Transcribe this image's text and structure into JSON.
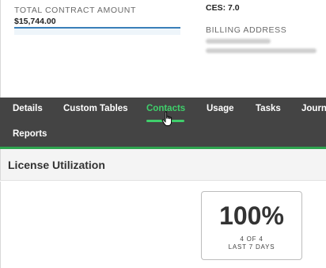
{
  "contract": {
    "amount_label": "TOTAL CONTRACT AMOUNT",
    "amount_value": "$15,744.00"
  },
  "ces": "CES: 7.0",
  "billing": {
    "label": "BILLING ADDRESS",
    "line1": "(obscured)",
    "line2": "(obscured)"
  },
  "tabs": [
    {
      "label": "Details"
    },
    {
      "label": "Custom Tables"
    },
    {
      "label": "Contacts"
    },
    {
      "label": "Usage"
    },
    {
      "label": "Tasks"
    },
    {
      "label": "Journ"
    },
    {
      "label": "Reports"
    }
  ],
  "active_tab": "Contacts",
  "section": {
    "title": "License Utilization"
  },
  "utilization": {
    "percent": "100%",
    "count": "4 OF 4",
    "period": "LAST 7 DAYS"
  },
  "colors": {
    "nav_bg": "#444444",
    "accent_green": "#3fcf6b",
    "amount_underline": "#3a7fb9"
  }
}
